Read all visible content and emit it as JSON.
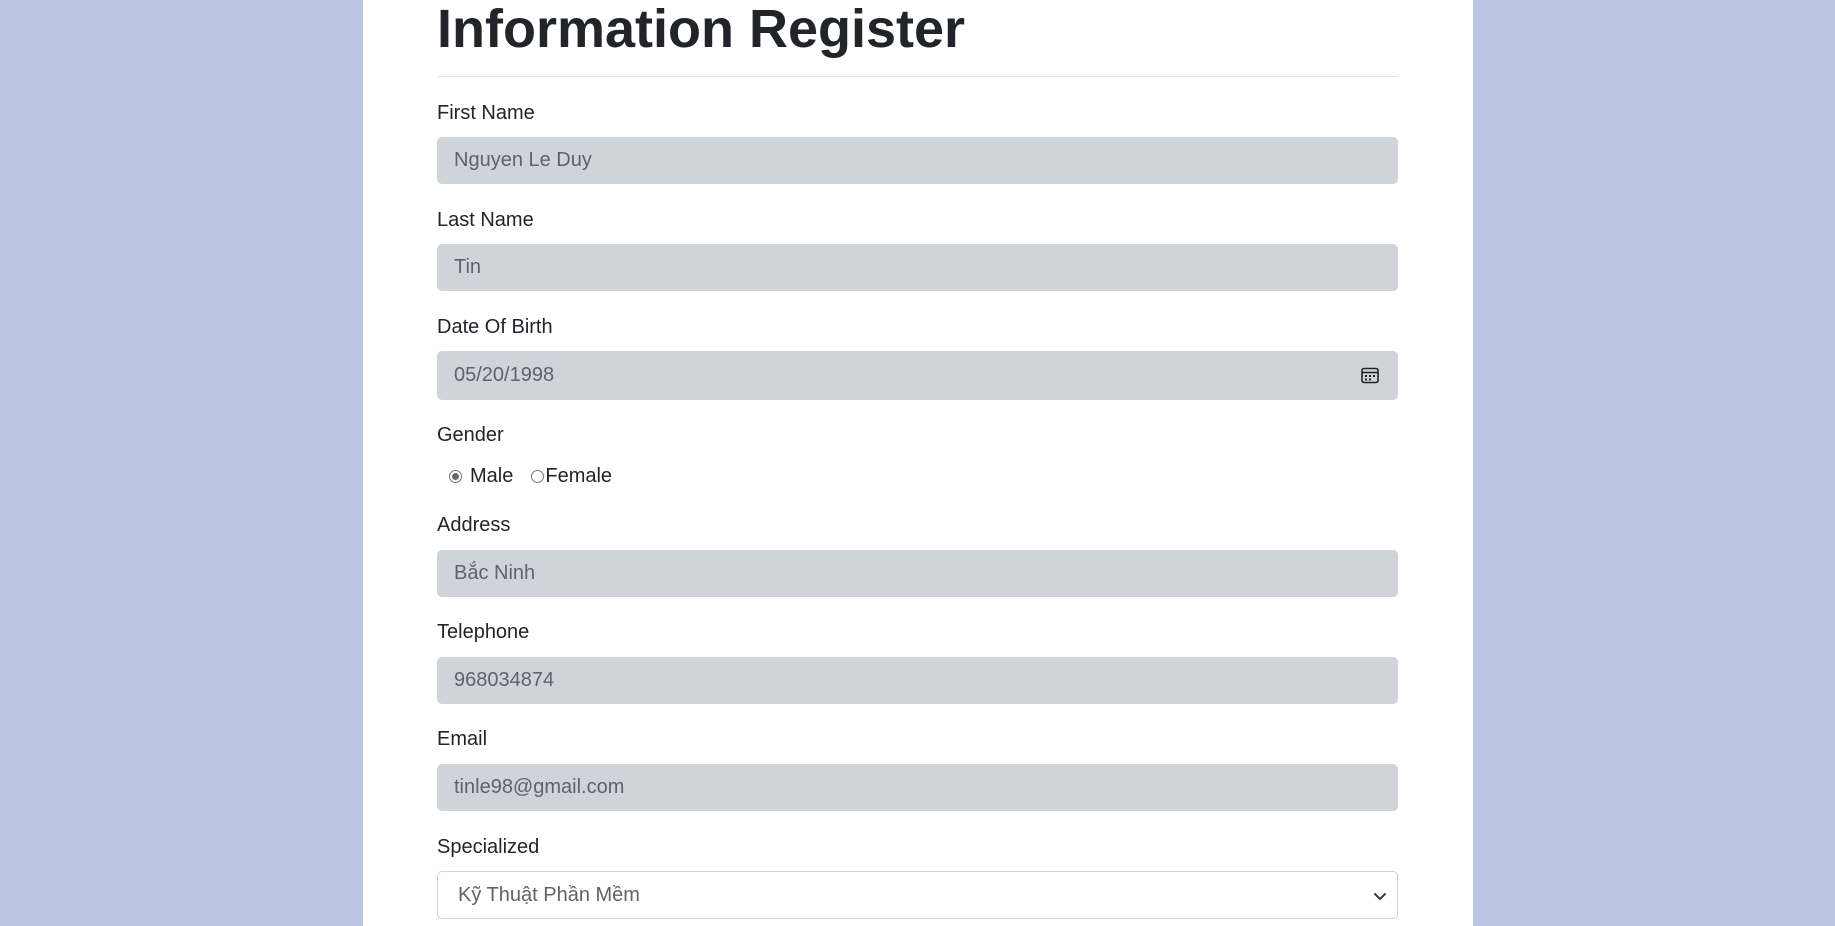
{
  "form": {
    "title": "Information Register",
    "first_name": {
      "label": "First Name",
      "value": "Nguyen Le Duy"
    },
    "last_name": {
      "label": "Last Name",
      "value": "Tin"
    },
    "dob": {
      "label": "Date Of Birth",
      "value": "05/20/1998"
    },
    "gender": {
      "label": "Gender",
      "options": [
        "Male",
        "Female"
      ],
      "selected": "Male"
    },
    "address": {
      "label": "Address",
      "value": "Bắc Ninh"
    },
    "telephone": {
      "label": "Telephone",
      "value": "968034874"
    },
    "email": {
      "label": "Email",
      "value": "tinle98@gmail.com"
    },
    "specialized": {
      "label": "Specialized",
      "value": "Kỹ Thuật Phần Mềm"
    }
  },
  "icons": {
    "date": "calendar-icon",
    "select": "chevron-down-icon"
  },
  "colors": {
    "page_background": "#bcc6e2",
    "card_background": "#ffffff",
    "field_background": "#cfd4db",
    "text": "#212529",
    "field_text": "#5c636a"
  }
}
